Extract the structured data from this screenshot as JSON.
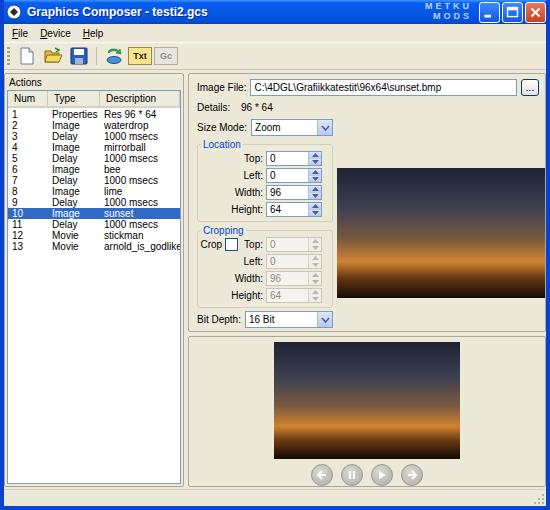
{
  "window": {
    "title": "Graphics Composer - testi2.gcs"
  },
  "watermark": {
    "top": "METKU",
    "bottom": "MODS"
  },
  "menu": [
    {
      "label": "File"
    },
    {
      "label": "Device"
    },
    {
      "label": "Help"
    }
  ],
  "toolbar": [
    {
      "kind": "new"
    },
    {
      "kind": "open"
    },
    {
      "kind": "save"
    },
    {
      "kind": "device"
    },
    {
      "kind": "text",
      "label": "Txt",
      "disabled": false
    },
    {
      "kind": "text",
      "label": "Gc",
      "disabled": true
    }
  ],
  "actions": {
    "title": "Actions",
    "columns": [
      "Num",
      "Type",
      "Description"
    ],
    "rows": [
      {
        "num": "1",
        "type": "Properties",
        "description": "Res 96 * 64",
        "selected": false
      },
      {
        "num": "2",
        "type": "Image",
        "description": "waterdrop",
        "selected": false
      },
      {
        "num": "3",
        "type": "Delay",
        "description": "1000 msecs",
        "selected": false
      },
      {
        "num": "4",
        "type": "Image",
        "description": "mirrorball",
        "selected": false
      },
      {
        "num": "5",
        "type": "Delay",
        "description": "1000 msecs",
        "selected": false
      },
      {
        "num": "6",
        "type": "Image",
        "description": "bee",
        "selected": false
      },
      {
        "num": "7",
        "type": "Delay",
        "description": "1000 msecs",
        "selected": false
      },
      {
        "num": "8",
        "type": "Image",
        "description": "lime",
        "selected": false
      },
      {
        "num": "9",
        "type": "Delay",
        "description": "1000 msecs",
        "selected": false
      },
      {
        "num": "10",
        "type": "Image",
        "description": "sunset",
        "selected": true
      },
      {
        "num": "11",
        "type": "Delay",
        "description": "1000 msecs",
        "selected": false
      },
      {
        "num": "12",
        "type": "Movie",
        "description": "stickman",
        "selected": false
      },
      {
        "num": "13",
        "type": "Movie",
        "description": "arnold_is_godlike",
        "selected": false
      }
    ]
  },
  "image_file": {
    "label": "Image File:",
    "value": "C:\\4DGL\\Grafiikkatestit\\96x64\\sunset.bmp",
    "browse": "..."
  },
  "details": {
    "label": "Details:",
    "value": "96 * 64"
  },
  "size_mode": {
    "label": "Size Mode:",
    "value": "Zoom"
  },
  "location": {
    "title": "Location",
    "fields": [
      {
        "label": "Top:",
        "value": "0"
      },
      {
        "label": "Left:",
        "value": "0"
      },
      {
        "label": "Width:",
        "value": "96"
      },
      {
        "label": "Height:",
        "value": "64"
      }
    ]
  },
  "cropping": {
    "title": "Cropping",
    "crop": {
      "label": "Crop",
      "checked": false
    },
    "fields": [
      {
        "label": "Top:",
        "value": "0",
        "disabled": true
      },
      {
        "label": "Left:",
        "value": "0",
        "disabled": true
      },
      {
        "label": "Width:",
        "value": "96",
        "disabled": true
      },
      {
        "label": "Height:",
        "value": "64",
        "disabled": true
      }
    ]
  },
  "bit_depth": {
    "label": "Bit Depth:",
    "value": "16 Bit"
  },
  "player": [
    {
      "kind": "back",
      "disabled": true
    },
    {
      "kind": "pause",
      "disabled": true
    },
    {
      "kind": "play",
      "disabled": true
    },
    {
      "kind": "forward",
      "disabled": true
    }
  ]
}
